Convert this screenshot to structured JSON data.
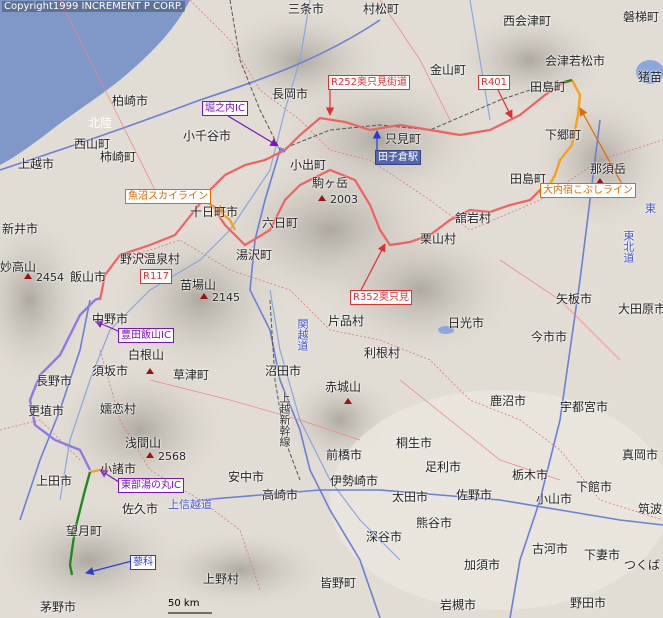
{
  "map": {
    "copyright": "Copyright1999 INCREMENT P CORP.",
    "scale_label": "50 km",
    "colors": {
      "sea": "#7f98c8",
      "land": "#e2ddd4",
      "mountain": "#b9b5ad",
      "route_red": "#f26060",
      "route_purple": "#8c7ae6",
      "route_orange": "#f5a020",
      "route_green": "#1f8a1f",
      "river": "#8ca6e0"
    },
    "places": [
      {
        "id": "sanjo",
        "text": "三条市"
      },
      {
        "id": "muramatsu",
        "text": "村松町"
      },
      {
        "id": "nishiaizu",
        "text": "西会津町"
      },
      {
        "id": "bandai",
        "text": "磐梯町"
      },
      {
        "id": "kanayama",
        "text": "金山町"
      },
      {
        "id": "aizuwakamatsu",
        "text": "会津若松市"
      },
      {
        "id": "kashiwazaki",
        "text": "柏崎市"
      },
      {
        "id": "nagaoka",
        "text": "長岡市"
      },
      {
        "id": "tajima",
        "text": "田島町"
      },
      {
        "id": "kitariku",
        "text": "北陸"
      },
      {
        "id": "nishiyama",
        "text": "西山町"
      },
      {
        "id": "ojiya",
        "text": "小千谷市"
      },
      {
        "id": "tadami",
        "text": "只見町"
      },
      {
        "id": "shimogo",
        "text": "下郷町"
      },
      {
        "id": "joetsu",
        "text": "上越市"
      },
      {
        "id": "kakizaki",
        "text": "柿崎町"
      },
      {
        "id": "koide",
        "text": "小出町"
      },
      {
        "id": "komagatake",
        "text": "駒ヶ岳"
      },
      {
        "id": "nasu",
        "text": "那須岳"
      },
      {
        "id": "tokamachi",
        "text": "十日町市"
      },
      {
        "id": "muikamachi",
        "text": "六日町"
      },
      {
        "id": "tateiwa",
        "text": "舘岩村"
      },
      {
        "id": "tajima2",
        "text": "田島町"
      },
      {
        "id": "arai",
        "text": "新井市"
      },
      {
        "id": "yuzawa",
        "text": "湯沢町"
      },
      {
        "id": "kuriyama",
        "text": "栗山村"
      },
      {
        "id": "myoko",
        "text": "妙高山"
      },
      {
        "id": "nozawa",
        "text": "野沢温泉村"
      },
      {
        "id": "iiyama",
        "text": "飯山市"
      },
      {
        "id": "naeba",
        "text": "苗場山"
      },
      {
        "id": "yaita",
        "text": "矢板市"
      },
      {
        "id": "otawara",
        "text": "大田原市"
      },
      {
        "id": "nakano",
        "text": "中野市"
      },
      {
        "id": "katashina",
        "text": "片品村"
      },
      {
        "id": "nikko",
        "text": "日光市"
      },
      {
        "id": "imaichi",
        "text": "今市市"
      },
      {
        "id": "shirane",
        "text": "白根山"
      },
      {
        "id": "suzaka",
        "text": "須坂市"
      },
      {
        "id": "kusatsu",
        "text": "草津町"
      },
      {
        "id": "tone",
        "text": "利根村"
      },
      {
        "id": "nagano",
        "text": "長野市"
      },
      {
        "id": "numata",
        "text": "沼田市"
      },
      {
        "id": "kanuma",
        "text": "鹿沼市"
      },
      {
        "id": "utsunomiya",
        "text": "宇都宮市"
      },
      {
        "id": "konsei",
        "text": "更埴市"
      },
      {
        "id": "tsumagoi",
        "text": "嬬恋村"
      },
      {
        "id": "akagi",
        "text": "赤城山"
      },
      {
        "id": "asama",
        "text": "浅間山"
      },
      {
        "id": "kiryu",
        "text": "桐生市"
      },
      {
        "id": "ashikaga",
        "text": "足利市"
      },
      {
        "id": "tochigi",
        "text": "栃木市"
      },
      {
        "id": "oyama",
        "text": "小山市"
      },
      {
        "id": "moka",
        "text": "真岡市"
      },
      {
        "id": "maebashi",
        "text": "前橋市"
      },
      {
        "id": "ueda",
        "text": "上田市"
      },
      {
        "id": "komoro",
        "text": "小諸市"
      },
      {
        "id": "annaka",
        "text": "安中市"
      },
      {
        "id": "isesaki",
        "text": "伊勢崎市"
      },
      {
        "id": "takasaki",
        "text": "高崎市"
      },
      {
        "id": "ota",
        "text": "太田市"
      },
      {
        "id": "sano",
        "text": "佐野市"
      },
      {
        "id": "shimodate",
        "text": "下館市"
      },
      {
        "id": "saku",
        "text": "佐久市"
      },
      {
        "id": "kumagaya",
        "text": "熊谷市"
      },
      {
        "id": "tsukuba",
        "text": "筑波山"
      },
      {
        "id": "mochizuki",
        "text": "望月町"
      },
      {
        "id": "fukaya",
        "text": "深谷市"
      },
      {
        "id": "koga",
        "text": "古河市"
      },
      {
        "id": "shimotsuma",
        "text": "下妻市"
      },
      {
        "id": "kazo",
        "text": "加須市"
      },
      {
        "id": "tsukubashi",
        "text": "つくば"
      },
      {
        "id": "ueno",
        "text": "上野村"
      },
      {
        "id": "chichibu",
        "text": "皆野町"
      },
      {
        "id": "chino",
        "text": "茅野市"
      },
      {
        "id": "iwatsuki",
        "text": "岩槻市"
      },
      {
        "id": "higashi",
        "text": "東"
      },
      {
        "id": "bandaishi",
        "text": "猪苗"
      },
      {
        "id": "noda",
        "text": "野田市"
      }
    ],
    "road_labels": [
      {
        "id": "kanetsu",
        "text": "関越道"
      },
      {
        "id": "joetsu_shinkansen",
        "text": "上越新幹線"
      },
      {
        "id": "jo_shinetsu",
        "text": "上信越道"
      },
      {
        "id": "tohoku",
        "text": "東北道"
      }
    ],
    "callouts": [
      {
        "id": "r252",
        "text": "R252奥只見街道",
        "color": "red"
      },
      {
        "id": "r401",
        "text": "R401",
        "color": "red"
      },
      {
        "id": "horinouchi",
        "text": "堀之内IC",
        "color": "purple"
      },
      {
        "id": "tagokura",
        "text": "田子倉駅",
        "color": "slate"
      },
      {
        "id": "uonuma",
        "text": "魚沼スカイライン",
        "color": "orange"
      },
      {
        "id": "ouchijuku",
        "text": "大内宿こぶしライン",
        "color": "orange"
      },
      {
        "id": "r117",
        "text": "R117",
        "color": "red"
      },
      {
        "id": "r352",
        "text": "R352奥只見",
        "color": "red"
      },
      {
        "id": "toyota_iiyama",
        "text": "豊田飯山IC",
        "color": "purple"
      },
      {
        "id": "tobu_yunomaru",
        "text": "東部湯の丸IC",
        "color": "purple"
      },
      {
        "id": "tateshina",
        "text": "蓼科",
        "color": "blue"
      }
    ],
    "peaks": [
      {
        "id": "komagatake_elev",
        "text": "2003"
      },
      {
        "id": "myoko_elev",
        "text": "2454"
      },
      {
        "id": "naeba_elev",
        "text": "2145"
      },
      {
        "id": "asama_elev",
        "text": "2568"
      }
    ]
  }
}
